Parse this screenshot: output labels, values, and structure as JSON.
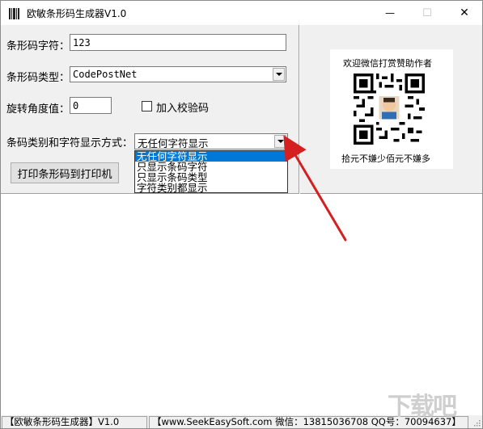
{
  "window": {
    "title": "欧敏条形码生成器V1.0",
    "minimize": "—",
    "maximize": "☐",
    "close": "✕"
  },
  "form": {
    "barcode_text_label": "条形码字符：",
    "barcode_text_value": "123",
    "barcode_type_label": "条形码类型：",
    "barcode_type_value": "CodePostNet",
    "rotation_label": "旋转角度值：",
    "rotation_value": "0",
    "checksum_label": "加入校验码",
    "checksum_checked": false,
    "display_mode_label": "条码类别和字符显示方式：",
    "display_mode_value": "无任何字符显示",
    "print_button": "打印条形码到打印机"
  },
  "dropdown": {
    "options": [
      "无任何字符显示",
      "只显示条码字符",
      "只显示条码类型",
      "字符类别都显示"
    ],
    "selected_index": 0
  },
  "qr": {
    "caption_top": "欢迎微信打赏赞助作者",
    "caption_bottom": "拾元不嫌少佰元不嫌多"
  },
  "status": {
    "left": "【欧敏条形码生成器】V1.0",
    "right": "【www.SeekEasySoft.com 微信：13815036708 QQ号：70094637】"
  },
  "watermark": "下载吧",
  "icons": {
    "app": "barcode-icon",
    "dropdown_arrow": "chevron-down-icon"
  },
  "colors": {
    "selection": "#0078d7",
    "annotation_arrow": "#d42020",
    "panel": "#f0f0f0"
  }
}
